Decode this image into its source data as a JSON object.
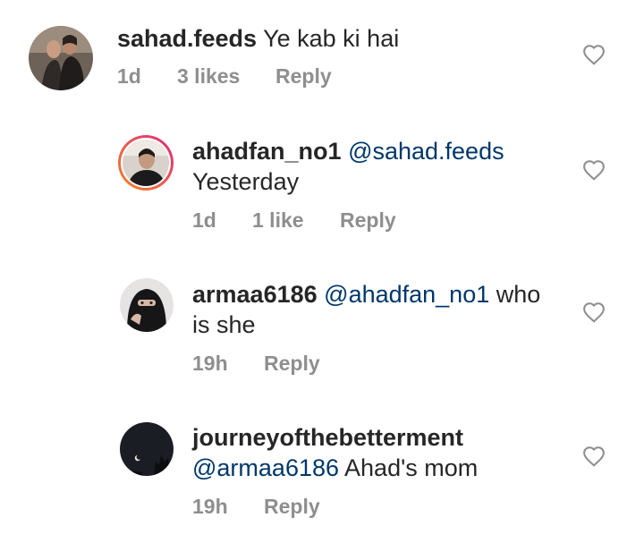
{
  "comments": [
    {
      "username": "sahad.feeds",
      "mention": "",
      "text": "Ye kab ki hai",
      "time": "1d",
      "likes": "3 likes",
      "reply_label": "Reply",
      "avatar_icon": "profile-photo-couple",
      "heart_icon": "heart-outline-icon"
    },
    {
      "username": "ahadfan_no1",
      "mention": "@sahad.feeds",
      "text": "Yesterday",
      "time": "1d",
      "likes": "1 like",
      "reply_label": "Reply",
      "avatar_icon": "profile-photo-story-ring",
      "heart_icon": "heart-outline-icon"
    },
    {
      "username": "armaa6186",
      "mention": "@ahadfan_no1",
      "text_line1_suffix": "who",
      "text_line2": "is she",
      "time": "19h",
      "likes": "",
      "reply_label": "Reply",
      "avatar_icon": "profile-photo-niqab",
      "heart_icon": "heart-outline-icon"
    },
    {
      "username": "journeyofthebetterment",
      "mention": "@armaa6186",
      "text": "Ahad's mom",
      "time": "19h",
      "likes": "",
      "reply_label": "Reply",
      "avatar_icon": "profile-photo-night-sky",
      "heart_icon": "heart-outline-icon"
    }
  ],
  "colors": {
    "text": "#262626",
    "mention": "#00376b",
    "meta": "#8e8e8e",
    "story_ring_start": "#f58529",
    "story_ring_end": "#dd2a7b"
  }
}
